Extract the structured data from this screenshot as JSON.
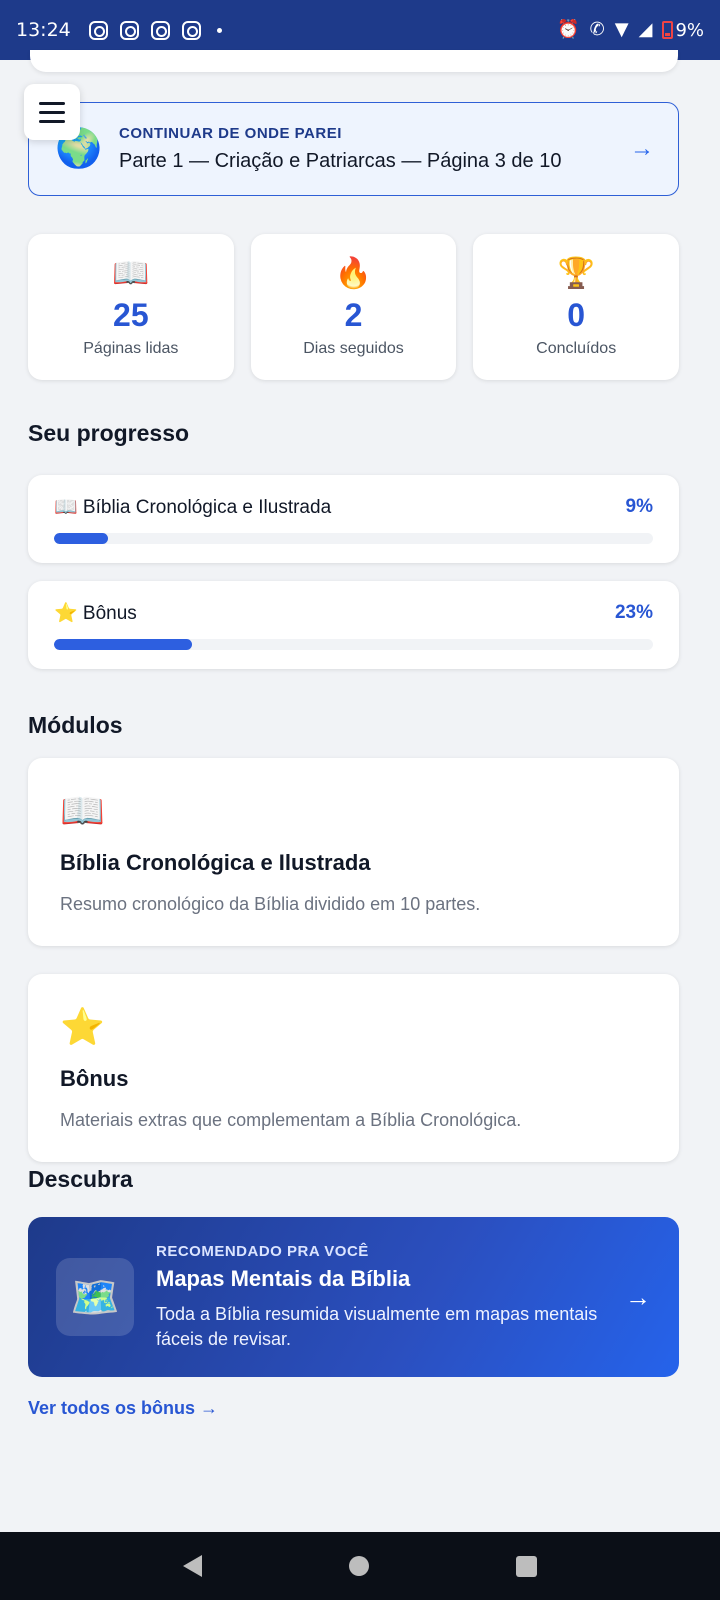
{
  "status_bar": {
    "time": "13:24",
    "notification_icons": [
      "instagram-icon",
      "instagram-icon",
      "instagram-icon",
      "instagram-icon"
    ],
    "battery": "9%"
  },
  "continue": {
    "kicker": "CONTINUAR DE ONDE PAREI",
    "title": "Parte 1 — Criação e Patriarcas — Página 3 de 10",
    "icon": "🌍",
    "arrow": "→"
  },
  "stats": [
    {
      "icon": "📖",
      "value": "25",
      "label": "Páginas lidas"
    },
    {
      "icon": "🔥",
      "value": "2",
      "label": "Dias seguidos"
    },
    {
      "icon": "🏆",
      "value": "0",
      "label": "Concluídos"
    }
  ],
  "progress": {
    "title": "Seu progresso",
    "items": [
      {
        "name": "📖 Bíblia Cronológica e Ilustrada",
        "percent": "9%",
        "value": 0.09
      },
      {
        "name": "⭐ Bônus",
        "percent": "23%",
        "value": 0.23
      }
    ]
  },
  "modules": {
    "title": "Módulos",
    "items": [
      {
        "icon": "📖",
        "title": "Bíblia Cronológica e Ilustrada",
        "description": "Resumo cronológico da Bíblia dividido em 10 partes."
      },
      {
        "icon": "⭐",
        "title": "Bônus",
        "description": "Materiais extras que complementam a Bíblia Cronológica."
      }
    ]
  },
  "discover": {
    "title": "Descubra",
    "promo": {
      "kicker": "RECOMENDADO PRA VOCÊ",
      "title": "Mapas Mentais da Bíblia",
      "description": "Toda a Bíblia resumida visualmente em mapas mentais fáceis de revisar.",
      "icon": "🗺️",
      "arrow": "→"
    },
    "link": "Ver todos os bônus →"
  },
  "colors": {
    "primary": "#2856d3",
    "header": "#1e3a8a",
    "background": "#f1f3f6"
  }
}
